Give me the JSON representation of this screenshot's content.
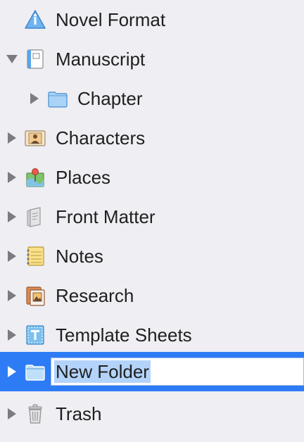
{
  "binder": {
    "items": [
      {
        "label": "Novel Format"
      },
      {
        "label": "Manuscript"
      },
      {
        "label": "Chapter"
      },
      {
        "label": "Characters"
      },
      {
        "label": "Places"
      },
      {
        "label": "Front Matter"
      },
      {
        "label": "Notes"
      },
      {
        "label": "Research"
      },
      {
        "label": "Template Sheets"
      },
      {
        "label": "New Folder"
      },
      {
        "label": "Trash"
      }
    ]
  },
  "colors": {
    "background": "#efeef3",
    "selection": "#2d7cf6",
    "text_selection": "#b3d3fb"
  }
}
